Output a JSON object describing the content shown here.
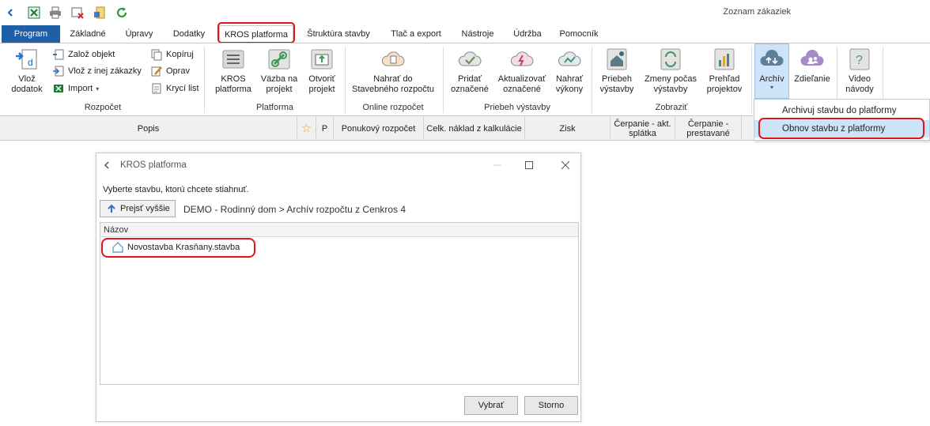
{
  "app": {
    "title": "Zoznam zákaziek",
    "tabs": [
      {
        "label": "Program"
      },
      {
        "label": "Základné"
      },
      {
        "label": "Úpravy"
      },
      {
        "label": "Dodatky"
      },
      {
        "label": "KROS platforma"
      },
      {
        "label": "Štruktúra stavby"
      },
      {
        "label": "Tlač a export"
      },
      {
        "label": "Nástroje"
      },
      {
        "label": "Údržba"
      },
      {
        "label": "Pomocník"
      }
    ],
    "active_tab": "KROS platforma",
    "ribbon": {
      "rozpocet": {
        "label": "Rozpočet",
        "vloz_dodatok": "Vlož dodatok",
        "small": [
          "Založ objekt",
          "Vlož z inej zákazky",
          "Import",
          "Kopíruj",
          "Oprav",
          "Krycí list"
        ]
      },
      "platforma": {
        "label": "Platforma",
        "buttons": [
          "KROS platforma",
          "Väzba na projekt",
          "Otvoriť projekt"
        ]
      },
      "online": {
        "label": "Online rozpočet",
        "button": "Nahrať do Stavebného rozpočtu"
      },
      "priebeh": {
        "label": "Priebeh výstavby",
        "buttons": [
          "Pridať označené",
          "Aktualizovať označené",
          "Nahrať výkony"
        ]
      },
      "zobrazit": {
        "label": "Zobraziť",
        "buttons": [
          "Priebeh výstavby",
          "Zmeny počas výstavby",
          "Prehľad projektov"
        ]
      },
      "archiv": "Archív",
      "zdielanie": "Zdieľanie",
      "video": "Video návody"
    },
    "columns": [
      "Popis",
      "P",
      "Ponukový rozpočet",
      "Celk. náklad z kalkulácie",
      "Zisk",
      "Čerpanie - akt. splátka",
      "Čerpanie - prestavané"
    ],
    "dropdown": [
      "Archivuj stavbu do platformy",
      "Obnov stavbu z platformy"
    ],
    "colors": {
      "program_tab": "#1f5fa7",
      "highlight": "#e0151b",
      "selection": "#cde3f7"
    }
  },
  "dialog": {
    "title": "KROS platforma",
    "prompt": "Vyberte stavbu, ktorú chcete stiahnuť.",
    "up_button": "Prejsť vyššie",
    "path": "DEMO - Rodinný dom > Archív rozpočtu z Cenkros 4",
    "column_header": "Názov",
    "items": [
      {
        "name": "Novostavba Krasňany.stavba"
      }
    ],
    "ok": "Vybrať",
    "cancel": "Storno"
  }
}
